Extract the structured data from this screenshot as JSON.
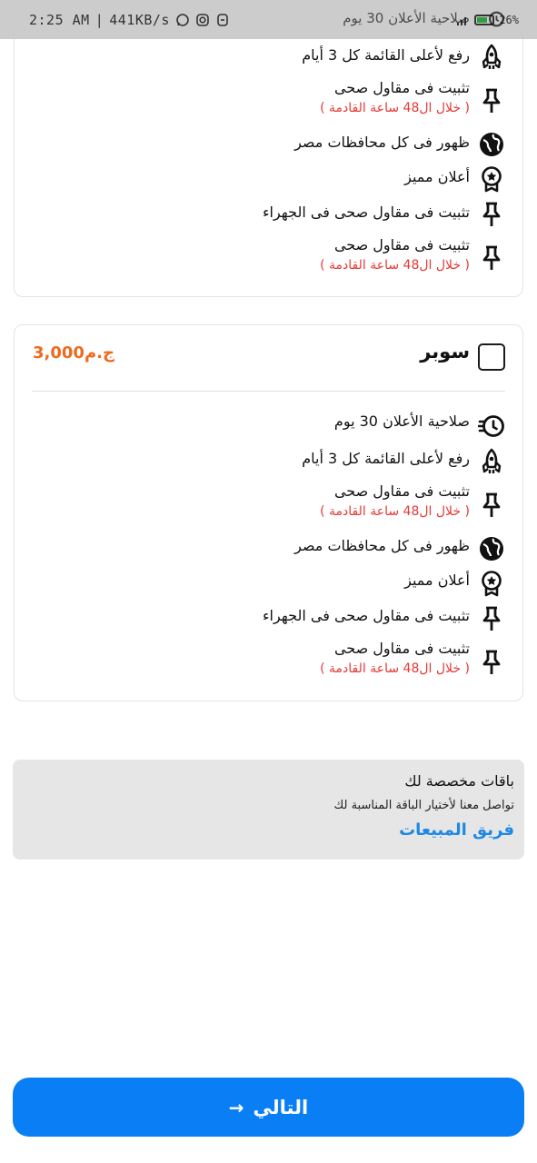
{
  "status_bar": {
    "time": "2:25 AM",
    "network_speed": "441KB/s",
    "battery": "26%"
  },
  "packages": [
    {
      "name": "",
      "price": "",
      "features": [
        {
          "icon": "rocket-icon",
          "text": "رفع لأعلى القائمة كل 3 أيام"
        },
        {
          "icon": "pin-icon",
          "text": "تثبيت فى مقاول صحى",
          "note": "( خلال ال48 ساعة القادمة )"
        },
        {
          "icon": "globe-icon",
          "text": "ظهور فى كل محافظات مصر"
        },
        {
          "icon": "badge-icon",
          "text": "أعلان مميز"
        },
        {
          "icon": "pin-icon",
          "text": "تثبيت فى مقاول صحى فى الجهراء"
        },
        {
          "icon": "pin-icon",
          "text": "تثبيت فى مقاول صحى",
          "note": "( خلال ال48 ساعة القادمة )"
        }
      ]
    },
    {
      "name": "سوبر",
      "price": "3,000ج.م",
      "features": [
        {
          "icon": "timer-icon",
          "text": "صلاحية الأعلان 30 يوم"
        },
        {
          "icon": "rocket-icon",
          "text": "رفع لأعلى القائمة كل 3 أيام"
        },
        {
          "icon": "pin-icon",
          "text": "تثبيت فى مقاول صحى",
          "note": "( خلال ال48 ساعة القادمة )"
        },
        {
          "icon": "globe-icon",
          "text": "ظهور فى كل محافظات مصر"
        },
        {
          "icon": "badge-icon",
          "text": "أعلان مميز"
        },
        {
          "icon": "pin-icon",
          "text": "تثبيت فى مقاول صحى فى الجهراء"
        },
        {
          "icon": "pin-icon",
          "text": "تثبيت فى مقاول صحى",
          "note": "( خلال ال48 ساعة القادمة )"
        }
      ]
    }
  ],
  "peek_feature": {
    "text": "صلاحية الأعلان 30 يوم"
  },
  "custom_packages": {
    "title": "باقات مخصصة لك",
    "description": "تواصل معنا لأختيار الباقة المناسبة لك",
    "link": "فريق المبيعات"
  },
  "next_button": {
    "label": "التالي",
    "arrow": "→"
  },
  "colors": {
    "accent": "#0a7ff5",
    "price": "#ee6a1f",
    "note": "#e53935",
    "link": "#1e88e5"
  }
}
